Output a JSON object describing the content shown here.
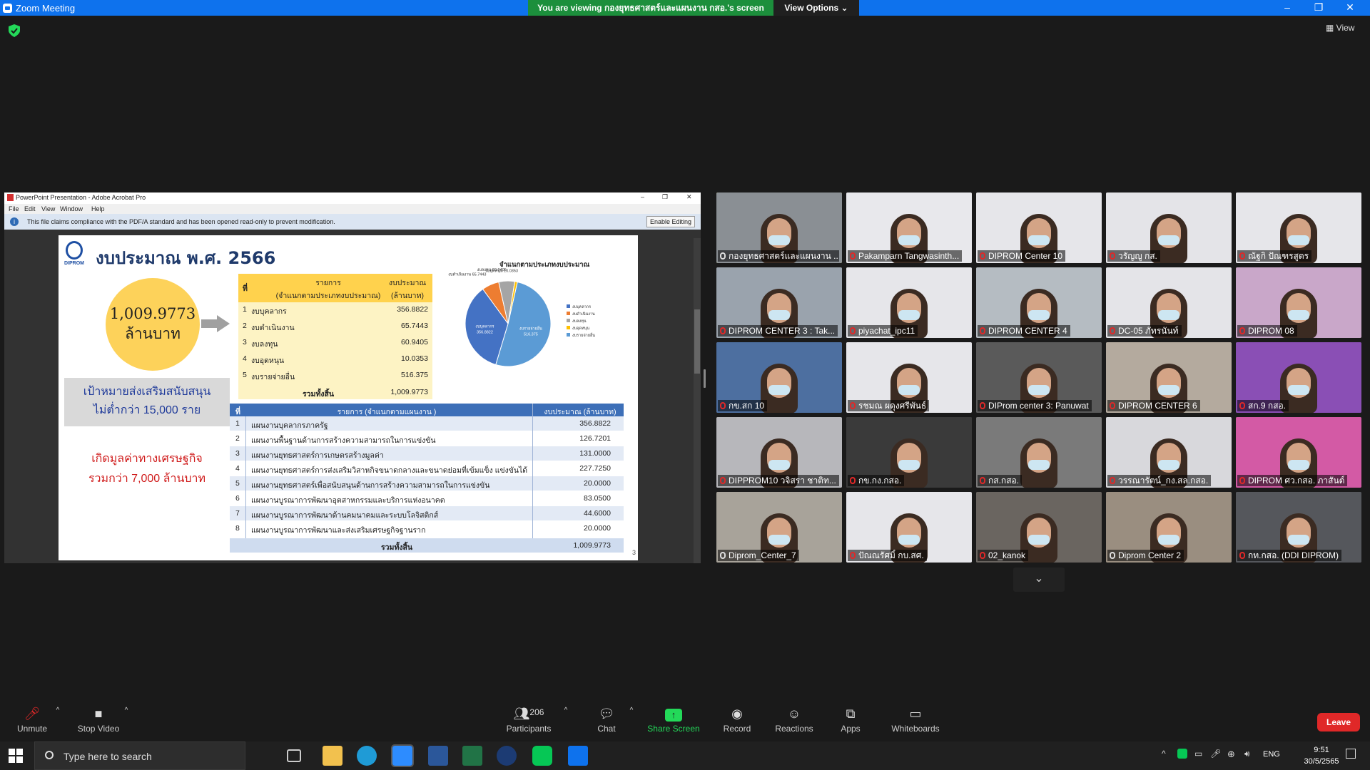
{
  "window": {
    "title": "Zoom Meeting",
    "min": "–",
    "restore": "❐",
    "close": "✕"
  },
  "banner": {
    "text": "You are viewing กองยุทธศาสตร์และแผนงาน กสอ.'s screen",
    "view_options": "View Options ⌄"
  },
  "view_label": "View",
  "acrobat": {
    "title": "PowerPoint Presentation - Adobe Acrobat Pro",
    "menu": [
      "File",
      "Edit",
      "View",
      "Window",
      "Help"
    ],
    "info": "This file claims compliance with the PDF/A standard and has been opened read-only to prevent modification.",
    "enable_editing": "Enable Editing"
  },
  "slide": {
    "logo_text": "DIPROM",
    "title": "งบประมาณ พ.ศ. 2566",
    "total_amount": "1,009.9773",
    "total_unit": "ล้านบาท",
    "goal_line1": "เป้าหมายส่งเสริมสนับสนุน",
    "goal_line2": "ไม่ต่ำกว่า 15,000 ราย",
    "value_line1": "เกิดมูลค่าทางเศรษฐกิจ",
    "value_line2": "รวมกว่า 7,000  ล้านบาท",
    "page_no": "3",
    "table1": {
      "h_no": "ที่",
      "h_item": "รายการ",
      "h_item2": "(จำแนกตามประเภทงบประมาณ)",
      "h_budget": "งบประมาณ",
      "h_budget2": "(ล้านบาท)",
      "rows": [
        {
          "no": "1",
          "item": "งบบุคลากร",
          "amount": "356.8822"
        },
        {
          "no": "2",
          "item": "งบดำเนินงาน",
          "amount": "65.7443"
        },
        {
          "no": "3",
          "item": "งบลงทุน",
          "amount": "60.9405"
        },
        {
          "no": "4",
          "item": "งบอุดหนุน",
          "amount": "10.0353"
        },
        {
          "no": "5",
          "item": "งบรายจ่ายอื่น",
          "amount": "516.375"
        }
      ],
      "total_label": "รวมทั้งสิ้น",
      "total": "1,009.9773"
    },
    "table2": {
      "h_no": "ที่",
      "h_item": "รายการ (จำแนกตามแผนงาน )",
      "h_budget": "งบประมาณ (ล้านบาท)",
      "rows": [
        {
          "no": "1",
          "item": "แผนงานบุคลากรภาครัฐ",
          "amount": "356.8822"
        },
        {
          "no": "2",
          "item": "แผนงานพื้นฐานด้านการสร้างความสามารถในการแข่งขัน",
          "amount": "126.7201"
        },
        {
          "no": "3",
          "item": "แผนงานยุทธศาสตร์การเกษตรสร้างมูลค่า",
          "amount": "131.0000"
        },
        {
          "no": "4",
          "item": "แผนงานยุทธศาสตร์การส่งเสริมวิสาหกิจขนาดกลางและขนาดย่อมที่เข้มแข็ง แข่งขันได้",
          "amount": "227.7250"
        },
        {
          "no": "5",
          "item": "แผนงานยุทธศาสตร์เพื่อสนับสนุนด้านการสร้างความสามารถในการแข่งขัน",
          "amount": "20.0000"
        },
        {
          "no": "6",
          "item": "แผนงานบูรณาการพัฒนาอุตสาหกรรมและบริการแห่งอนาคต",
          "amount": "83.0500"
        },
        {
          "no": "7",
          "item": "แผนงานบูรณาการพัฒนาด้านคมนาคมและระบบโลจิสติกส์",
          "amount": "44.6000"
        },
        {
          "no": "8",
          "item": "แผนงานบูรณาการพัฒนาและส่งเสริมเศรษฐกิจฐานราก",
          "amount": "20.0000"
        }
      ],
      "total_label": "รวมทั้งสิ้น",
      "total": "1,009.9773"
    }
  },
  "chart_data": {
    "type": "pie",
    "title": "จำแนกตามประเภทงบประมาณ",
    "categories": [
      "งบบุคลากร",
      "งบดำเนินงาน",
      "งบลงทุน",
      "งบอุดหนุน",
      "งบรายจ่ายอื่น"
    ],
    "values": [
      356.8822,
      65.7443,
      60.9405,
      10.0353,
      516.375
    ],
    "colors": [
      "#4472c4",
      "#ed7d31",
      "#a5a5a5",
      "#ffc000",
      "#5b9bd5"
    ],
    "slice_labels": [
      "งบบุคลากร 356.8822",
      "งบดำเนินงาน 65.7443",
      "งบลงทุน 60.9405",
      "งบอุดหนุน 10.0353",
      "งบรายจ่ายอื่น 516.375"
    ],
    "legend": "right"
  },
  "participants": [
    {
      "name": "กองยุทธศาสตร์และแผนงาน ...",
      "muted": false,
      "active": true,
      "bg": "#8a8f94"
    },
    {
      "name": "Pakamparn Tangwasinth...",
      "muted": true,
      "bg": "#e8e8ec"
    },
    {
      "name": "DIPROM Center 10",
      "muted": true,
      "bg": "#e6e6ea"
    },
    {
      "name": "วรัญญู กส.",
      "muted": true,
      "bg": "#e4e4e8"
    },
    {
      "name": "ณัฐกิ ปัณฑรสูตร",
      "muted": true,
      "bg": "#e6e6ea"
    },
    {
      "name": "DIPROM CENTER 3 : Tak...",
      "muted": true,
      "bg": "#9aa3ad"
    },
    {
      "name": "piyachat_ipc11",
      "muted": true,
      "bg": "#e6e6ea"
    },
    {
      "name": "DIPROM CENTER 4",
      "muted": true,
      "bg": "#b5bcc2"
    },
    {
      "name": "DC-05 ภัทรนันท์",
      "muted": true,
      "bg": "#e4e4e8"
    },
    {
      "name": "DIPROM 08",
      "muted": true,
      "bg": "#c9a7c9"
    },
    {
      "name": "กข.สก 10",
      "muted": true,
      "bg": "#4d6fa0"
    },
    {
      "name": "รชมณ ผดุงศรีพันธ์",
      "muted": true,
      "bg": "#e6e6ea"
    },
    {
      "name": "DIProm center 3: Panuwat",
      "muted": true,
      "bg": "#5a5a5a"
    },
    {
      "name": "DIPROM CENTER 6",
      "muted": true,
      "bg": "#b4aa9e"
    },
    {
      "name": "สก.9 กสอ.",
      "muted": true,
      "bg": "#8a4fb5"
    },
    {
      "name": "DIPPROM10 วจิสรา ชาติท...",
      "muted": true,
      "bg": "#b7b7bb"
    },
    {
      "name": "กข.กง.กสอ.",
      "muted": true,
      "bg": "#3a3a3a"
    },
    {
      "name": "กส.กสอ.",
      "muted": true,
      "bg": "#7a7a7a"
    },
    {
      "name": "วรรณารัตน์_กง.สล.กสอ.",
      "muted": true,
      "bg": "#d8d8dc"
    },
    {
      "name": "DIPROM ศว.กสอ. ภาสันต์",
      "muted": true,
      "bg": "#d35aa5"
    },
    {
      "name": "Diprom_Center_7",
      "muted": false,
      "bg": "#a8a39a"
    },
    {
      "name": "ปัณณรัศมิ์ กบ.สศ.",
      "muted": true,
      "bg": "#e6e6ea"
    },
    {
      "name": "02_kanok",
      "muted": true,
      "bg": "#6a6560"
    },
    {
      "name": "Diprom Center 2",
      "muted": false,
      "bg": "#9a8e80"
    },
    {
      "name": "กท.กสอ. (DDI DIPROM)",
      "muted": true,
      "bg": "#55575c"
    }
  ],
  "toolbar": {
    "unmute": "Unmute",
    "stop_video": "Stop Video",
    "participants": "Participants",
    "participants_count": "206",
    "chat": "Chat",
    "share_screen": "Share Screen",
    "record": "Record",
    "reactions": "Reactions",
    "apps": "Apps",
    "whiteboards": "Whiteboards",
    "leave": "Leave"
  },
  "taskbar": {
    "search_placeholder": "Type here to search",
    "lang": "ENG",
    "time": "9:51",
    "date": "30/5/2565"
  }
}
